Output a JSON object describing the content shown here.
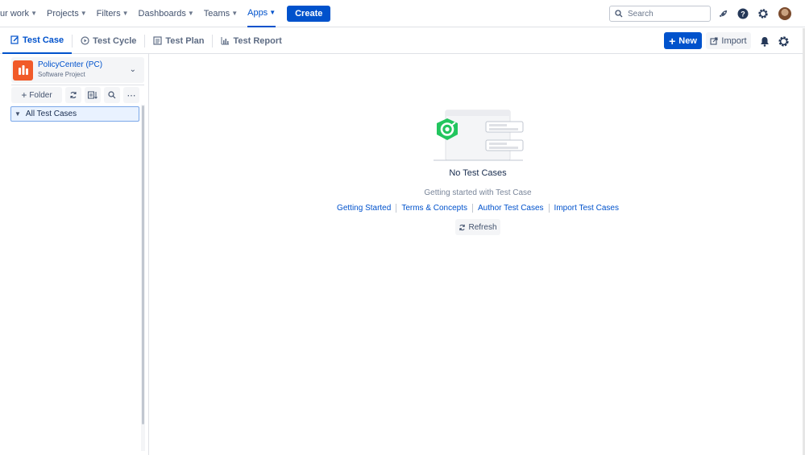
{
  "topnav": {
    "items": [
      {
        "label": "ur work"
      },
      {
        "label": "Projects"
      },
      {
        "label": "Filters"
      },
      {
        "label": "Dashboards"
      },
      {
        "label": "Teams"
      },
      {
        "label": "Apps"
      }
    ],
    "active_item": "Apps",
    "create_label": "Create",
    "search_placeholder": "Search",
    "icons": [
      "search-icon",
      "rocket-icon",
      "help-icon",
      "settings-icon",
      "avatar"
    ]
  },
  "tabs": [
    {
      "label": "Test Case",
      "icon": "test-case-icon",
      "active": true
    },
    {
      "label": "Test Cycle",
      "icon": "test-cycle-icon",
      "active": false
    },
    {
      "label": "Test Plan",
      "icon": "test-plan-icon",
      "active": false
    },
    {
      "label": "Test Report",
      "icon": "test-report-icon",
      "active": false
    }
  ],
  "actions": {
    "new_label": "New",
    "import_label": "Import"
  },
  "sidebar": {
    "project_name": "PolicyCenter (PC)",
    "project_type": "Software Project",
    "folder_button_label": "Folder",
    "tree_root_label": "All Test Cases"
  },
  "empty_state": {
    "title": "No Test Cases",
    "subtitle": "Getting started with Test Case",
    "links": [
      "Getting Started",
      "Terms & Concepts",
      "Author Test Cases",
      "Import Test Cases"
    ],
    "refresh_label": "Refresh"
  },
  "colors": {
    "brand_blue": "#0052cc",
    "project_icon_bg": "#f15a29",
    "logo_green": "#22c55e"
  }
}
